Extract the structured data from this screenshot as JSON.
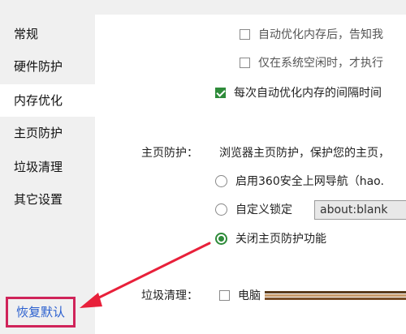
{
  "sidebar": {
    "items": [
      {
        "label": "常规"
      },
      {
        "label": "硬件防护"
      },
      {
        "label": "内存优化"
      },
      {
        "label": "主页防护"
      },
      {
        "label": "垃圾清理"
      },
      {
        "label": "其它设置"
      }
    ],
    "active_index": 2,
    "restore_label": "恢复默认"
  },
  "memory": {
    "auto_notify_label": "自动优化内存后，告知我",
    "idle_only_label": "仅在系统空闲时，才执行",
    "interval_label": "每次自动优化内存的间隔时间"
  },
  "homepage": {
    "section_label": "主页防护：",
    "description": "浏览器主页防护，保护您的主页，",
    "opt_360_label": "启用360安全上网导航（hao.",
    "opt_custom_label": "自定义锁定",
    "custom_url_value": "about:blank",
    "opt_off_label": "关闭主页防护功能",
    "selected_option": "off"
  },
  "cleanup": {
    "section_label": "垃圾清理：",
    "pc_label": "电脑"
  },
  "colors": {
    "accent_green": "#2e8b3a",
    "highlight_red": "#d0245a",
    "link_blue": "#2a5fcf"
  }
}
